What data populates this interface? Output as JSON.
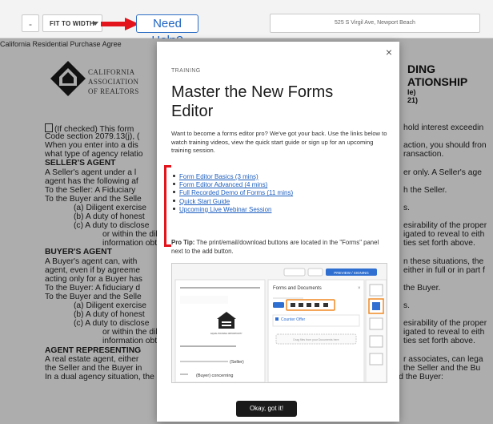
{
  "toolbar": {
    "minus_label": "-",
    "zoom_value": "FIT TO WIDTH",
    "help_label": "Need Help?",
    "address_value": "525 S Virgil Ave, Newport Beach"
  },
  "document": {
    "tab_label": "California Residential Purchase Agree",
    "logo_lines": [
      "CALIFORNIA",
      "ASSOCIATION",
      "OF REALTORS"
    ],
    "title_lines": [
      "DING",
      "ATIONSHIP"
    ],
    "title_sub_lines": [
      "le)",
      "21)"
    ],
    "lines": [
      {
        "text": "(If checked) This form",
        "bold": false,
        "checkbox": true
      },
      {
        "text": "Code section 2079.13(j), (",
        "bold": false
      },
      {
        "text": "When you enter into a dis",
        "bold": false
      },
      {
        "text": "what type of agency relatio",
        "bold": false
      },
      {
        "text": "SELLER'S AGENT",
        "bold": true
      },
      {
        "text": "A Seller's agent under a l",
        "bold": false
      },
      {
        "text": "agent has the following af",
        "bold": false
      },
      {
        "text": "To the Seller: A Fiduciary",
        "bold": false
      },
      {
        "text": "To the Buyer and the Selle",
        "bold": false
      },
      {
        "text": "(a)  Diligent exercise",
        "bold": false
      },
      {
        "text": "(b)  A duty of honest",
        "bold": false
      },
      {
        "text": "(c)  A duty to disclose",
        "bold": false
      },
      {
        "text": "or within the dilig",
        "bold": false
      },
      {
        "text": "information obtai",
        "bold": false
      },
      {
        "text": "BUYER'S AGENT",
        "bold": true
      },
      {
        "text": "A Buyer's agent can, with",
        "bold": false
      },
      {
        "text": "agent, even if by agreeme",
        "bold": false
      },
      {
        "text": "acting only for a Buyer has",
        "bold": false
      },
      {
        "text": "To the Buyer: A fiduciary d",
        "bold": false
      },
      {
        "text": "To the Buyer and the Selle",
        "bold": false
      },
      {
        "text": "(a)  Diligent exercise",
        "bold": false
      },
      {
        "text": "(b)  A duty of honest",
        "bold": false
      },
      {
        "text": "(c)  A duty to disclose",
        "bold": false
      },
      {
        "text": "or within the dilig",
        "bold": false
      },
      {
        "text": "information obtai",
        "bold": false
      },
      {
        "text": "AGENT REPRESENTING",
        "bold": true
      },
      {
        "text": "A real estate agent, either",
        "bold": false
      },
      {
        "text": "the Seller and the Buyer in",
        "bold": false
      },
      {
        "text": "In a dual agency situation, the agent has the following affirmative obligations to both the Seller and the Buyer:",
        "bold": false
      }
    ],
    "right_lines": [
      {
        "text": "hold interest exceedin",
        "bold": false
      },
      {
        "text": "action, you should fron",
        "bold": false
      },
      {
        "text": "ransaction.",
        "bold": false
      },
      {
        "text": "er only. A Seller's age",
        "bold": false
      },
      {
        "text": "h the Seller.",
        "bold": false
      },
      {
        "text": "s.",
        "bold": false
      },
      {
        "text": "esirability of the proper",
        "bold": false
      },
      {
        "text": "igated to reveal to eith",
        "bold": false
      },
      {
        "text": "ties set forth above.",
        "bold": false
      },
      {
        "text": "n these situations, the",
        "bold": false
      },
      {
        "text": "either in full or in part f",
        "bold": false
      },
      {
        "text": "the Buyer.",
        "bold": false
      },
      {
        "text": "s.",
        "bold": false
      },
      {
        "text": "esirability of the proper",
        "bold": false
      },
      {
        "text": "igated to reveal to eith",
        "bold": false
      },
      {
        "text": "ties set forth above.",
        "bold": false
      },
      {
        "text": "r associates, can lega",
        "bold": false
      },
      {
        "text": "the Seller and the Bu",
        "bold": false
      }
    ]
  },
  "modal": {
    "eyebrow": "TRAINING",
    "title": "Master the New Forms Editor",
    "intro": "Want to become a forms editor pro? We've got your back. Use the links below to watch training videos, view the quick start guide or sign up for an upcoming training session.",
    "links": [
      "Form Editor Basics (3 mins)",
      "Form Editor Advanced (4 mins)",
      "Full Recorded Demo of Forms (11 mins)",
      "Quick Start Guide",
      "Upcoming Live Webinar Session"
    ],
    "protip_label": "Pro Tip:",
    "protip_text": " The print/email/download buttons are located in the \"Forms\" panel next to the add button.",
    "preview": {
      "panel_title": "Forms and Documents",
      "doc_item": "Counter Offer",
      "drop_hint": "Drag files from your Documents here",
      "seller_label": "(Seller)",
      "buyer_label": "(Buyer) concerning",
      "equal_housing": "EQUAL HOUSING OPPORTUNITY",
      "top_btn": "PREVIEW / SIGNING"
    },
    "ok_label": "Okay, got it!",
    "close_symbol": "×"
  },
  "colors": {
    "accent": "#1f64c2",
    "annotation_red": "#e3141c"
  }
}
